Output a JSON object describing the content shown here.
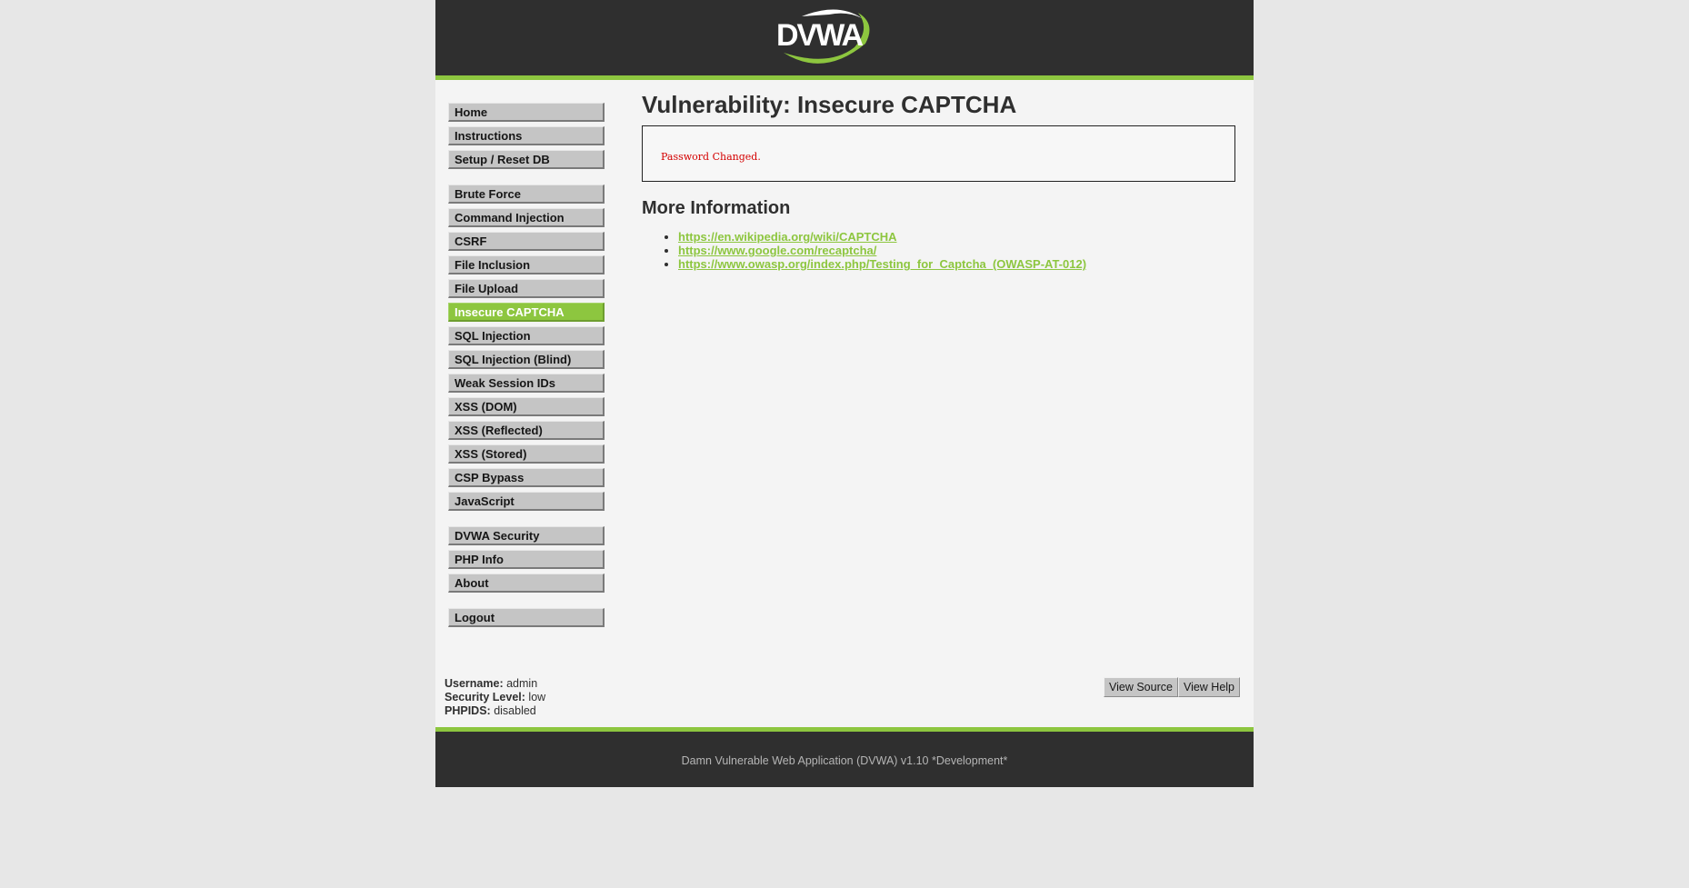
{
  "logo": {
    "text": "DVWA"
  },
  "menu": {
    "groups": [
      [
        {
          "label": "Home"
        },
        {
          "label": "Instructions"
        },
        {
          "label": "Setup / Reset DB"
        }
      ],
      [
        {
          "label": "Brute Force"
        },
        {
          "label": "Command Injection"
        },
        {
          "label": "CSRF"
        },
        {
          "label": "File Inclusion"
        },
        {
          "label": "File Upload"
        },
        {
          "label": "Insecure CAPTCHA",
          "selected": true
        },
        {
          "label": "SQL Injection"
        },
        {
          "label": "SQL Injection (Blind)"
        },
        {
          "label": "Weak Session IDs"
        },
        {
          "label": "XSS (DOM)"
        },
        {
          "label": "XSS (Reflected)"
        },
        {
          "label": "XSS (Stored)"
        },
        {
          "label": "CSP Bypass"
        },
        {
          "label": "JavaScript"
        }
      ],
      [
        {
          "label": "DVWA Security"
        },
        {
          "label": "PHP Info"
        },
        {
          "label": "About"
        }
      ],
      [
        {
          "label": "Logout"
        }
      ]
    ]
  },
  "main": {
    "title": "Vulnerability: Insecure CAPTCHA",
    "message": "Password Changed.",
    "more_info_title": "More Information",
    "links": [
      "https://en.wikipedia.org/wiki/CAPTCHA",
      "https://www.google.com/recaptcha/",
      "https://www.owasp.org/index.php/Testing_for_Captcha_(OWASP-AT-012)"
    ]
  },
  "user_info": {
    "username_label": "Username:",
    "username": "admin",
    "security_label": "Security Level:",
    "security": "low",
    "phpids_label": "PHPIDS:",
    "phpids": "disabled"
  },
  "buttons": {
    "view_source": "View Source",
    "view_help": "View Help"
  },
  "footer": {
    "text": "Damn Vulnerable Web Application (DVWA) v1.10 *Development*"
  },
  "colors": {
    "accent": "#8dc63f",
    "header_bg": "#2f2f2f",
    "message_red": "#d40000"
  }
}
